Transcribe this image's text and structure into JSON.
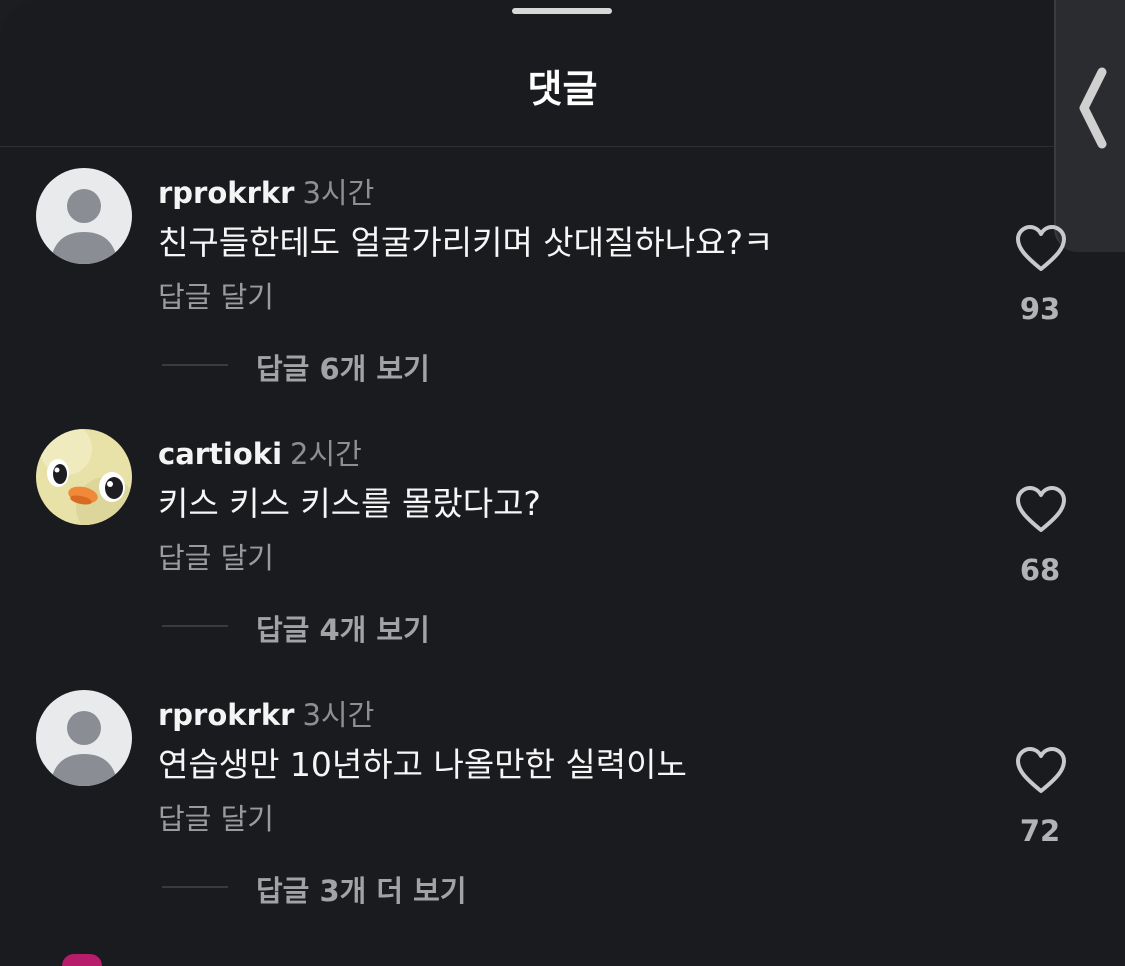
{
  "sheet": {
    "title": "댓글"
  },
  "comments": [
    {
      "username": "rprokrkr",
      "time": "3시간",
      "text": "친구들한테도 얼굴가리키며 삿대질하나요?ㅋ",
      "reply_label": "답글 달기",
      "view_replies": "답글 6개 보기",
      "likes": "93",
      "avatar": "default-avatar"
    },
    {
      "username": "cartioki",
      "time": "2시간",
      "text": "키스 키스 키스를 몰랐다고?",
      "reply_label": "답글 달기",
      "view_replies": "답글 4개 보기",
      "likes": "68",
      "avatar": "chick-avatar"
    },
    {
      "username": "rprokrkr",
      "time": "3시간",
      "text": "연습생만 10년하고 나올만한 실력이노",
      "reply_label": "답글 달기",
      "view_replies": "답글 3개 더 보기",
      "likes": "72",
      "avatar": "default-avatar"
    }
  ],
  "colors": {
    "background": "#1a1b1e",
    "muted_text": "#9a9b9f",
    "heart_outline": "#c8c9cc"
  },
  "icons": [
    "heart-outline-icon",
    "chevron-left-icon",
    "person-icon"
  ]
}
